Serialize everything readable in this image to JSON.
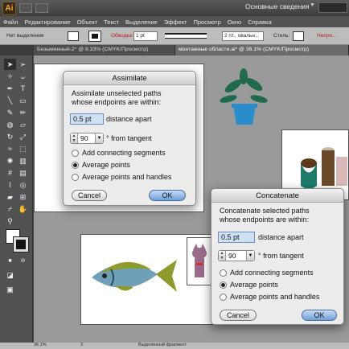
{
  "app": {
    "logo_text": "Ai",
    "workspace": "Основные сведения",
    "workspace_caret": "▼"
  },
  "menu": [
    "Файл",
    "Редактирование",
    "Объект",
    "Текст",
    "Выделение",
    "Эффект",
    "Просмотр",
    "Окно",
    "Справка"
  ],
  "control_bar": {
    "selection_label": "Нет выделения",
    "stroke_label": "Обводка:",
    "stroke_weight": "1 pt",
    "profile": "2 пт., овальн...",
    "style_label": "Стиль:",
    "opacity_label": "Непро..."
  },
  "tabs": [
    {
      "label": "Безымянный-2* @ 8.33% (CMYK/Просмотр)",
      "active": false
    },
    {
      "label": "монтажные области.ai* @ 36.1% (CMYK/Просмотр)",
      "active": true
    }
  ],
  "assimilate": {
    "title": "Assimilate",
    "line1": "Assimilate unselected paths",
    "line2": "whose endpoints are within:",
    "distance_value": "0.5 pt",
    "distance_label": "distance apart",
    "angle_value": "90",
    "angle_label": "° from tangent",
    "options": [
      "Add connecting segments",
      "Average points",
      "Average points and handles"
    ],
    "selected": 1,
    "cancel": "Cancel",
    "ok": "OK"
  },
  "concatenate": {
    "title": "Concatenate",
    "line1": "Concatenate selected paths",
    "line2": "whose endpoints are within:",
    "distance_value": "0.5 pt",
    "distance_label": "distance apart",
    "angle_value": "90",
    "angle_label": "° from tangent",
    "options": [
      "Add connecting segments",
      "Average points",
      "Average points and handles"
    ],
    "selected": 1,
    "cancel": "Cancel",
    "ok": "OK"
  },
  "status": {
    "zoom": "36.1%",
    "page": "3",
    "tool": "Выделенный фрагмент"
  },
  "colors": {
    "fish_body": "#6fa0b8",
    "fish_fin": "#8f9a2c",
    "plant": "#1f6a4a",
    "pot": "#2a8cc8",
    "ok_button": "#6f9fd8"
  }
}
